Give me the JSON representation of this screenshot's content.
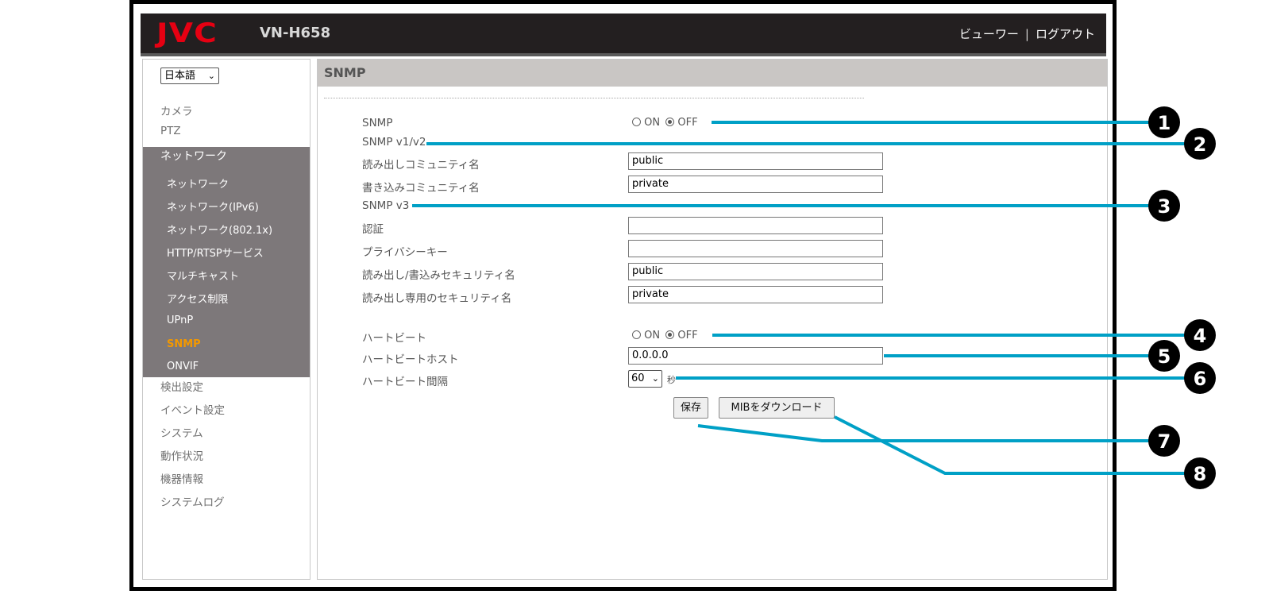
{
  "header": {
    "brand": "JVC",
    "model": "VN-H658",
    "viewer_link": "ビューワー",
    "separator": "|",
    "logout_link": "ログアウト"
  },
  "sidebar": {
    "language_select": "日本語",
    "items_top": [
      "カメラ",
      "PTZ"
    ],
    "network_section": "ネットワーク",
    "network_items": [
      "ネットワーク",
      "ネットワーク(IPv6)",
      "ネットワーク(802.1x)",
      "HTTP/RTSPサービス",
      "マルチキャスト",
      "アクセス制限",
      "UPnP",
      "SNMP",
      "ONVIF"
    ],
    "items_bottom": [
      "検出設定",
      "イベント設定",
      "システム",
      "動作状況",
      "機器情報",
      "システムログ"
    ]
  },
  "page": {
    "title": "SNMP",
    "snmp_label": "SNMP",
    "on_label": "ON",
    "off_label": "OFF",
    "snmp_v1v2_label": "SNMP v1/v2",
    "read_community_label": "読み出しコミュニティ名",
    "read_community_value": "public",
    "write_community_label": "書き込みコミュニティ名",
    "write_community_value": "private",
    "snmp_v3_label": "SNMP v3",
    "auth_label": "認証",
    "auth_value": "",
    "privacy_key_label": "プライバシーキー",
    "privacy_key_value": "",
    "rw_security_label": "読み出し/書込みセキュリティ名",
    "rw_security_value": "public",
    "ro_security_label": "読み出し専用のセキュリティ名",
    "ro_security_value": "private",
    "heartbeat_label": "ハートビート",
    "heartbeat_host_label": "ハートビートホスト",
    "heartbeat_host_value": "0.0.0.0",
    "heartbeat_interval_label": "ハートビート間隔",
    "heartbeat_interval_value": "60",
    "seconds_unit": "秒",
    "save_button": "保存",
    "mib_button": "MIBをダウンロード"
  },
  "callouts": [
    "1",
    "2",
    "3",
    "4",
    "5",
    "6",
    "7",
    "8"
  ],
  "colors": {
    "callout_line": "#00a0c6",
    "active_nav": "#f39800",
    "header_bg": "#231f20",
    "brand": "#e60012"
  }
}
